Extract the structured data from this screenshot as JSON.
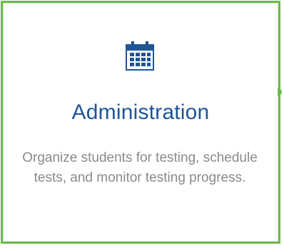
{
  "tile": {
    "title": "Administration",
    "description": "Organize students for testing, schedule tests, and monitor testing progress.",
    "icon": "calendar-icon",
    "colors": {
      "border": "#6abd45",
      "title": "#1f5596",
      "description": "#8a8a8a",
      "icon": "#1f5596"
    }
  }
}
